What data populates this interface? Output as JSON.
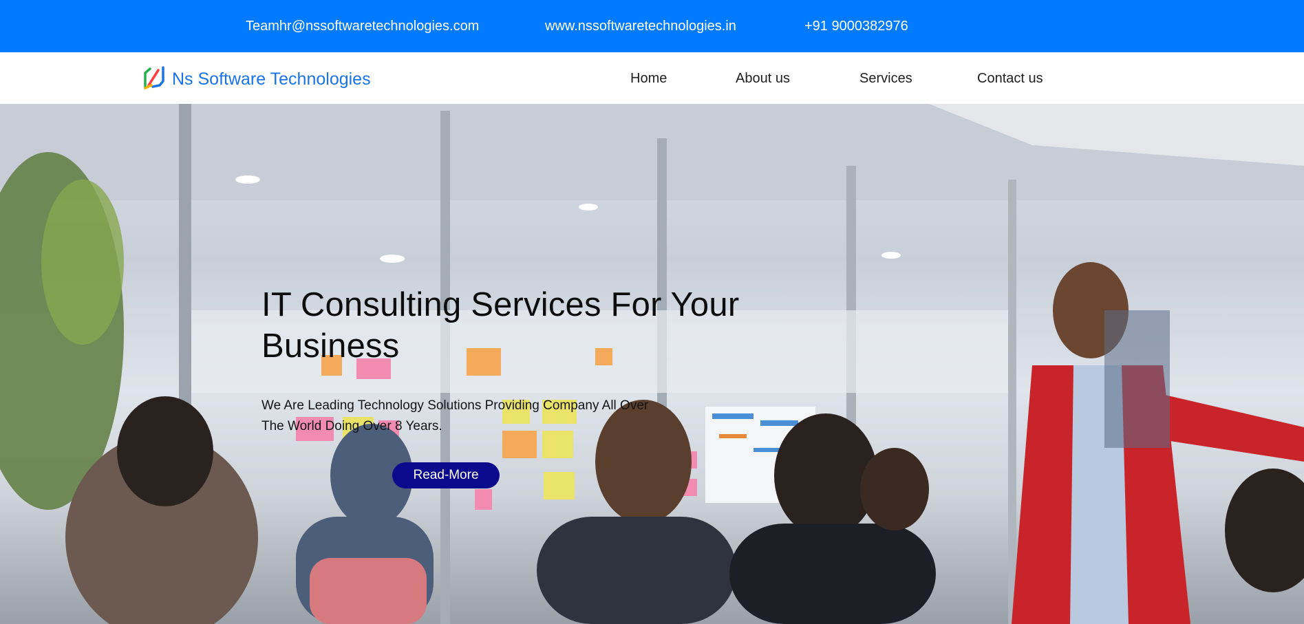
{
  "topbar": {
    "email": "Teamhr@nssoftwaretechnologies.com",
    "website": "www.nssoftwaretechnologies.in",
    "phone": "+91 9000382976"
  },
  "navbar": {
    "brand_name": "Ns Software Technologies",
    "logo_icon": "ns-logo-icon",
    "links": [
      "Home",
      "About us",
      "Services",
      "Contact us"
    ]
  },
  "hero": {
    "title": "IT Consulting Services For Your Business",
    "subtitle": "We Are Leading Technology Solutions Providing Company All Over The World Doing Over 8 Years.",
    "button_label": "Read-More"
  },
  "colors": {
    "topbar_bg": "#007bff",
    "brand_text": "#1a73e8",
    "button_bg": "#0b0a8c"
  }
}
